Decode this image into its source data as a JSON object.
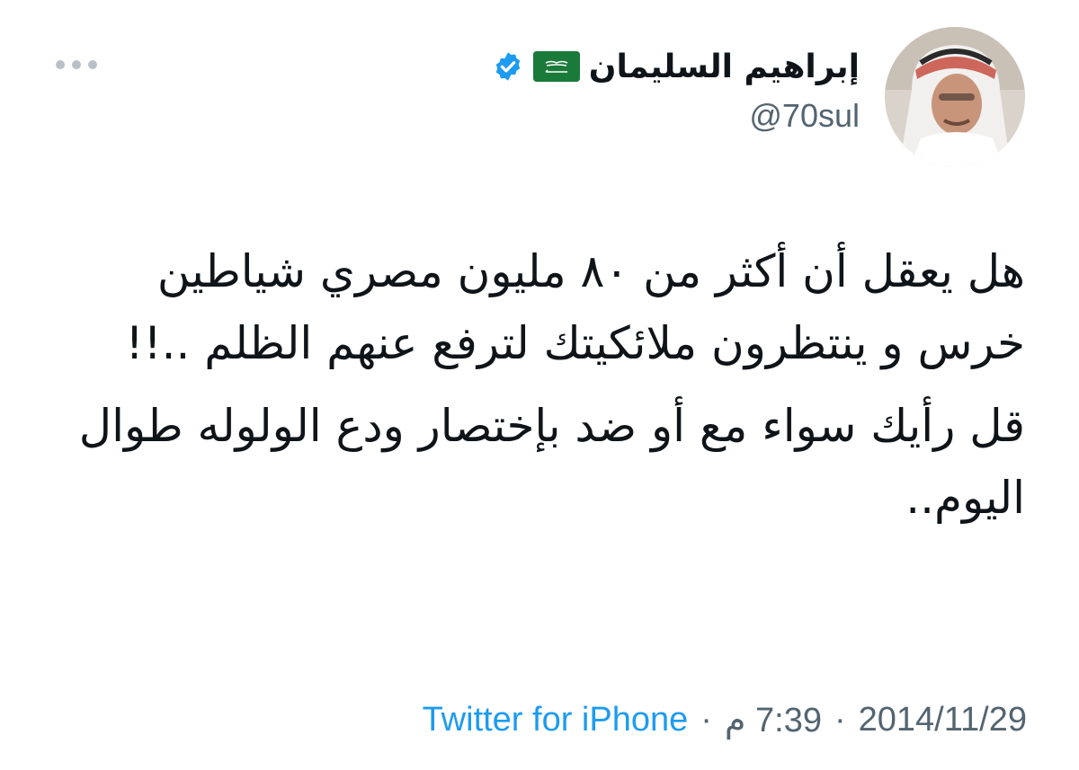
{
  "author": {
    "display_name": "إبراهيم السليمان",
    "handle": "@70sul",
    "flag_icon": "saudi-arabia-flag-icon",
    "verified_icon": "verified-badge-icon",
    "verified_color": "#1d9bf0"
  },
  "menu": {
    "more_icon": "more-options-icon"
  },
  "tweet": {
    "paragraphs": [
      "هل يعقل أن أكثر من ٨٠ مليون مصري شياطين خرس و ينتظرون ملائكيتك لترفع عنهم الظلم ..!!",
      "قل رأيك سواء مع أو ضد بإختصار ودع الولوله طوال اليوم.."
    ]
  },
  "meta": {
    "date": "2014/11/29",
    "separator": "·",
    "time": "7:39 م",
    "source": "Twitter for iPhone"
  },
  "colors": {
    "text": "#0f1419",
    "secondary": "#536471",
    "link": "#1d9bf0"
  }
}
